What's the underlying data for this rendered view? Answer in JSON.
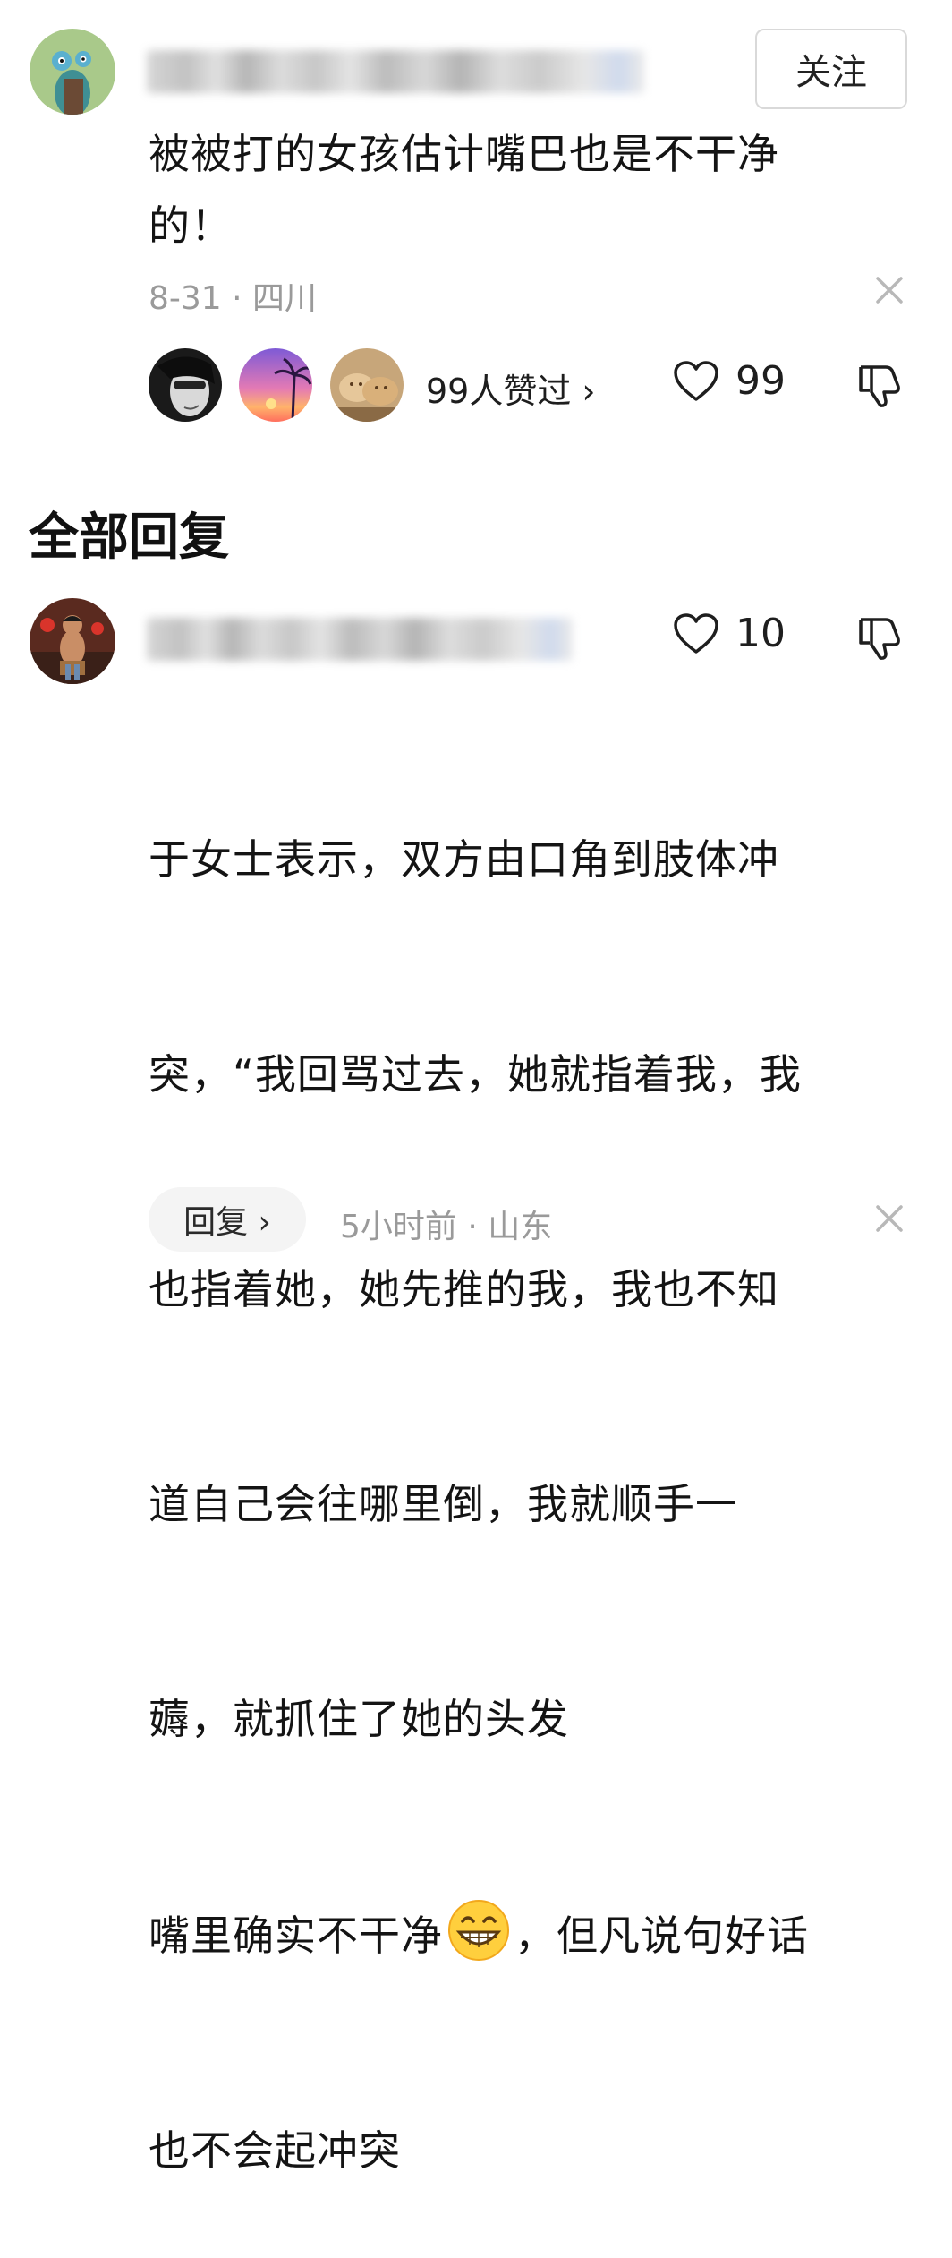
{
  "comment": {
    "follow_label": "关注",
    "text": "被被打的女孩估计嘴巴也是不干净\n的！",
    "meta": "8-31 · 四川",
    "likers_text": "99人赞过 ›",
    "like_count": "99"
  },
  "replies": {
    "section_title": "全部回复",
    "items": [
      {
        "like_count": "10",
        "text_line1": "于女士表示，双方由口角到肢体冲",
        "text_line2": "突，“我回骂过去，她就指着我，我",
        "text_line3": "也指着她，她先推的我，我也不知",
        "text_line4": "道自己会往哪里倒，我就顺手一",
        "text_line5": "薅，就抓住了她的头发",
        "text_line6a": " 嘴里确实不干净",
        "text_line6b": "，但凡说句好话",
        "text_line7": "也不会起冲突",
        "reply_label": "回复 ›",
        "meta": "5小时前 · 山东"
      }
    ]
  },
  "icons": {
    "heart": "heart-outline-icon",
    "dislike": "thumbs-down-icon",
    "close": "close-icon",
    "emoji": "grinning-emoji-icon"
  }
}
